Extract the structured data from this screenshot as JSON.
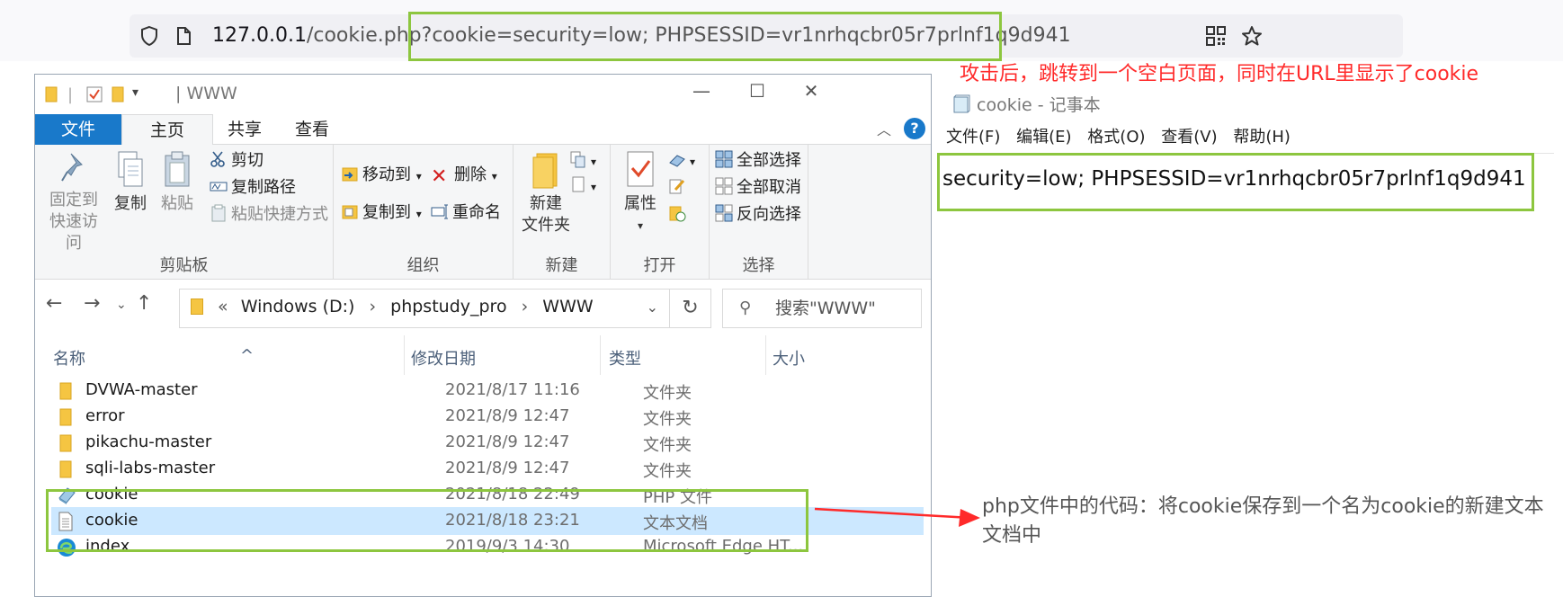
{
  "browser": {
    "url_host": "127.0.0.1",
    "url_rest": "/cookie.php?cookie=security=low; PHPSESSID=vr1nrhqcbr05r7prlnf1q9d941"
  },
  "annotations": {
    "top": "攻击后，跳转到一个空白页面，同时在URL里显示了cookie",
    "side": "php文件中的代码：将cookie保存到一个名为cookie的新建文本文档中",
    "color_red": "#ff2a2a",
    "color_green": "#8dc63f"
  },
  "explorer": {
    "title": "| WWW",
    "tabs": [
      "文件",
      "主页",
      "共享",
      "查看"
    ],
    "ribbon": {
      "clipboard": {
        "label": "剪贴板",
        "pin": "固定到快速访问",
        "copy": "复制",
        "paste": "粘贴",
        "cut": "剪切",
        "copy_path": "复制路径",
        "paste_shortcut": "粘贴快捷方式"
      },
      "organize": {
        "label": "组织",
        "move_to": "移动到",
        "copy_to": "复制到",
        "delete": "删除",
        "rename": "重命名"
      },
      "new": {
        "label": "新建",
        "new_folder": "新建\n文件夹"
      },
      "open": {
        "label": "打开",
        "properties": "属性"
      },
      "select": {
        "label": "选择",
        "select_all": "全部选择",
        "select_none": "全部取消",
        "invert": "反向选择"
      }
    },
    "address": {
      "crumbs": [
        "Windows (D:)",
        "phpstudy_pro",
        "WWW"
      ],
      "search_placeholder": "搜索\"WWW\""
    },
    "columns": [
      "名称",
      "修改日期",
      "类型",
      "大小"
    ],
    "files": [
      {
        "name": "DVWA-master",
        "date": "2021/8/17 11:16",
        "type": "文件夹",
        "icon": "folder-icon"
      },
      {
        "name": "error",
        "date": "2021/8/9 12:47",
        "type": "文件夹",
        "icon": "folder-icon"
      },
      {
        "name": "pikachu-master",
        "date": "2021/8/9 12:47",
        "type": "文件夹",
        "icon": "folder-icon"
      },
      {
        "name": "sqli-labs-master",
        "date": "2021/8/9 12:47",
        "type": "文件夹",
        "icon": "folder-icon"
      },
      {
        "name": "cookie",
        "date": "2021/8/18 22:49",
        "type": "PHP 文件",
        "icon": "php-file-icon"
      },
      {
        "name": "cookie",
        "date": "2021/8/18 23:21",
        "type": "文本文档",
        "icon": "text-file-icon"
      },
      {
        "name": "index",
        "date": "2019/9/3 14:30",
        "type": "Microsoft Edge HT...",
        "icon": "edge-icon"
      }
    ]
  },
  "notepad": {
    "title": "cookie - 记事本",
    "menu": [
      "文件(F)",
      "编辑(E)",
      "格式(O)",
      "查看(V)",
      "帮助(H)"
    ],
    "content": "security=low; PHPSESSID=vr1nrhqcbr05r7prlnf1q9d941"
  }
}
